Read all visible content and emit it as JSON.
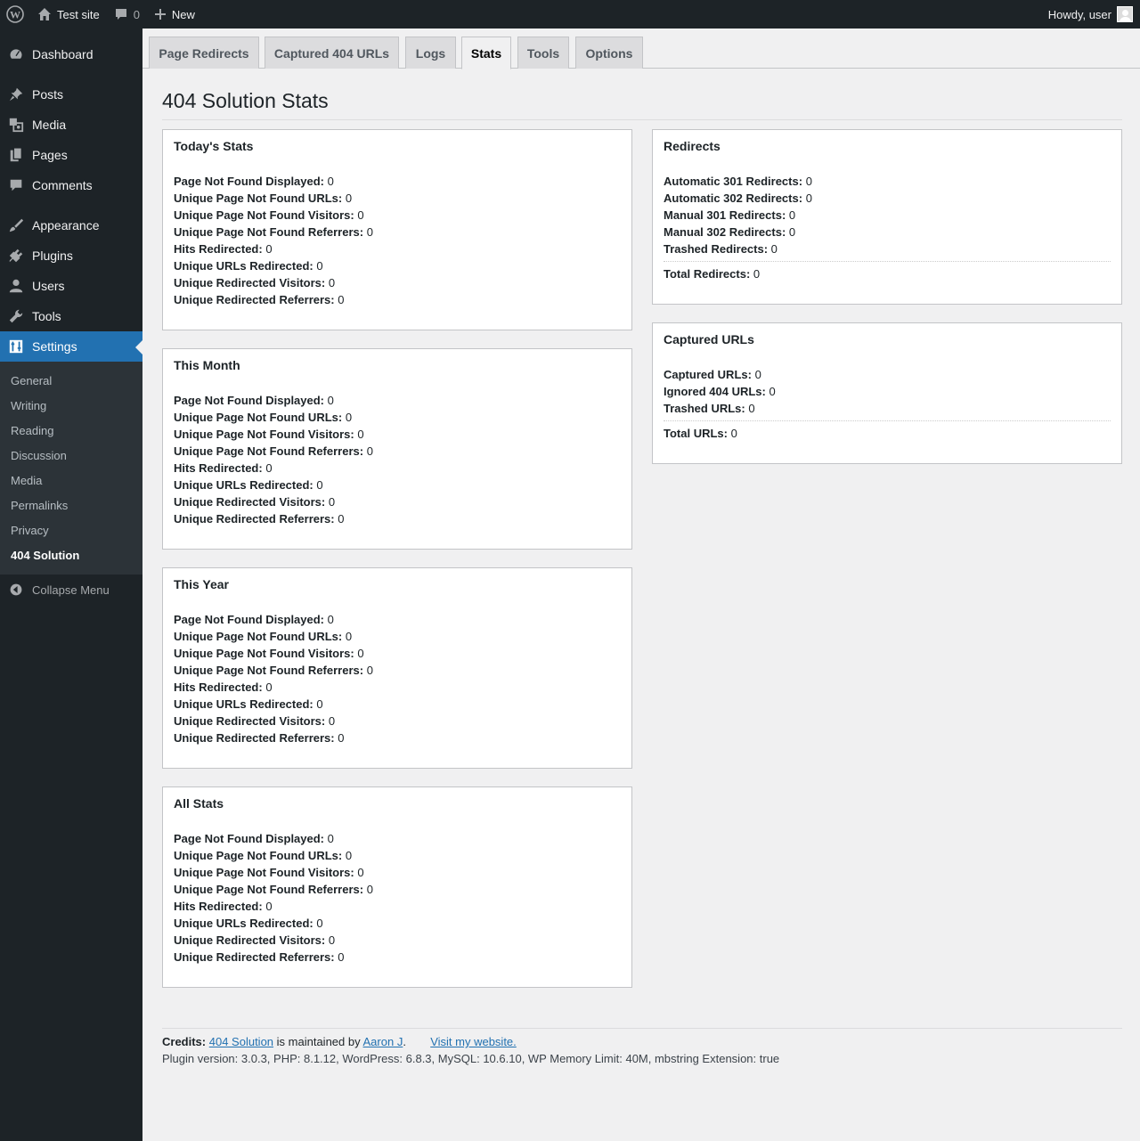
{
  "admin_bar": {
    "site_name": "Test site",
    "comments_count": "0",
    "new_label": "New",
    "greeting": "Howdy, user"
  },
  "sidebar": {
    "items": [
      {
        "label": "Dashboard",
        "icon": "dashboard-icon"
      },
      {
        "label": "Posts",
        "icon": "pin-icon"
      },
      {
        "label": "Media",
        "icon": "media-icon"
      },
      {
        "label": "Pages",
        "icon": "pages-icon"
      },
      {
        "label": "Comments",
        "icon": "comment-icon"
      },
      {
        "label": "Appearance",
        "icon": "brush-icon"
      },
      {
        "label": "Plugins",
        "icon": "plug-icon"
      },
      {
        "label": "Users",
        "icon": "user-icon"
      },
      {
        "label": "Tools",
        "icon": "wrench-icon"
      },
      {
        "label": "Settings",
        "icon": "sliders-icon"
      }
    ],
    "submenu": [
      "General",
      "Writing",
      "Reading",
      "Discussion",
      "Media",
      "Permalinks",
      "Privacy",
      "404 Solution"
    ],
    "collapse_label": "Collapse Menu"
  },
  "tabs": [
    "Page Redirects",
    "Captured 404 URLs",
    "Logs",
    "Stats",
    "Tools",
    "Options"
  ],
  "active_tab": "Stats",
  "page_title": "404 Solution Stats",
  "stat_labels": {
    "pnf_displayed": "Page Not Found Displayed:",
    "unique_pnf_urls": "Unique Page Not Found URLs:",
    "unique_pnf_visitors": "Unique Page Not Found Visitors:",
    "unique_pnf_referrers": "Unique Page Not Found Referrers:",
    "hits_redirected": "Hits Redirected:",
    "unique_urls_redirected": "Unique URLs Redirected:",
    "unique_redirected_visitors": "Unique Redirected Visitors:",
    "unique_redirected_referrers": "Unique Redirected Referrers:"
  },
  "stat_boxes": [
    {
      "title": "Today's Stats",
      "values": [
        "0",
        "0",
        "0",
        "0",
        "0",
        "0",
        "0",
        "0"
      ]
    },
    {
      "title": "This Month",
      "values": [
        "0",
        "0",
        "0",
        "0",
        "0",
        "0",
        "0",
        "0"
      ]
    },
    {
      "title": "This Year",
      "values": [
        "0",
        "0",
        "0",
        "0",
        "0",
        "0",
        "0",
        "0"
      ]
    },
    {
      "title": "All Stats",
      "values": [
        "0",
        "0",
        "0",
        "0",
        "0",
        "0",
        "0",
        "0"
      ]
    }
  ],
  "redirects_box": {
    "title": "Redirects",
    "lines": [
      {
        "label": "Automatic 301 Redirects:",
        "value": "0"
      },
      {
        "label": "Automatic 302 Redirects:",
        "value": "0"
      },
      {
        "label": "Manual 301 Redirects:",
        "value": "0"
      },
      {
        "label": "Manual 302 Redirects:",
        "value": "0"
      },
      {
        "label": "Trashed Redirects:",
        "value": "0"
      }
    ],
    "total": {
      "label": "Total Redirects:",
      "value": "0"
    }
  },
  "captured_box": {
    "title": "Captured URLs",
    "lines": [
      {
        "label": "Captured URLs:",
        "value": "0"
      },
      {
        "label": "Ignored 404 URLs:",
        "value": "0"
      },
      {
        "label": "Trashed URLs:",
        "value": "0"
      }
    ],
    "total": {
      "label": "Total URLs:",
      "value": "0"
    }
  },
  "footer": {
    "credits_label": "Credits:",
    "plugin_link": "404 Solution",
    "maintained_text": "is maintained by",
    "author_link": "Aaron J",
    "period": ".",
    "visit_link": "Visit my website.",
    "version_line": "Plugin version: 3.0.3, PHP: 8.1.12, WordPress: 6.8.3, MySQL: 10.6.10, WP Memory Limit: 40M, mbstring Extension: true"
  }
}
